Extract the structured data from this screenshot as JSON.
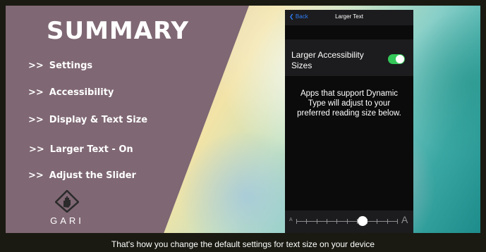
{
  "slide": {
    "title": "SUMMARY",
    "items": [
      {
        "arrows": ">>",
        "label": "Settings"
      },
      {
        "arrows": ">>",
        "label": "Accessibility"
      },
      {
        "arrows": ">>",
        "label": "Display & Text Size"
      },
      {
        "arrows": ">>",
        "label": "Larger Text - On"
      },
      {
        "arrows": ">>",
        "label": "Adjust the Slider"
      }
    ],
    "logo_text": "GARI"
  },
  "phone": {
    "nav": {
      "back_label": "❮ Back",
      "title": "Larger Text"
    },
    "toggle": {
      "label": "Larger Accessibility Sizes",
      "state": "on",
      "color": "#34c759"
    },
    "description": "Apps that support Dynamic Type will adjust to your preferred reading size below.",
    "slider": {
      "small_label": "A",
      "large_label": "A",
      "ticks": 11,
      "value_fraction": 0.65
    }
  },
  "caption": "That's how you change the default settings for text size on your device",
  "colors": {
    "panel": "#7f6773",
    "accent": "#2f7cf6",
    "toggle_on": "#34c759"
  }
}
